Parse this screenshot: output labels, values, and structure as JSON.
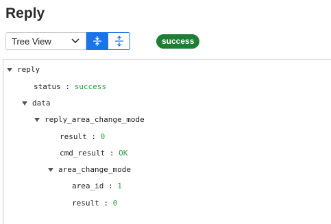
{
  "title": "Reply",
  "toolbar": {
    "view_select": {
      "selected": "Tree View"
    },
    "expand_all_icon": "expand-all-icon",
    "collapse_all_icon": "collapse-all-icon"
  },
  "status_badge": "success",
  "tree": {
    "root_key": "reply",
    "status_key": "status",
    "status_value": "success",
    "data_key": "data",
    "reply_area_change_mode_key": "reply_area_change_mode",
    "result_key": "result",
    "result_value": "0",
    "cmd_result_key": "cmd_result",
    "cmd_result_value": "OK",
    "area_change_mode_key": "area_change_mode",
    "area_id_key": "area_id",
    "area_id_value": "1",
    "inner_result_key": "result",
    "inner_result_value": "0",
    "separator": ":"
  },
  "colors": {
    "accent": "#1a73e8",
    "badge": "#1e7e34",
    "value": "#2f9e44"
  }
}
